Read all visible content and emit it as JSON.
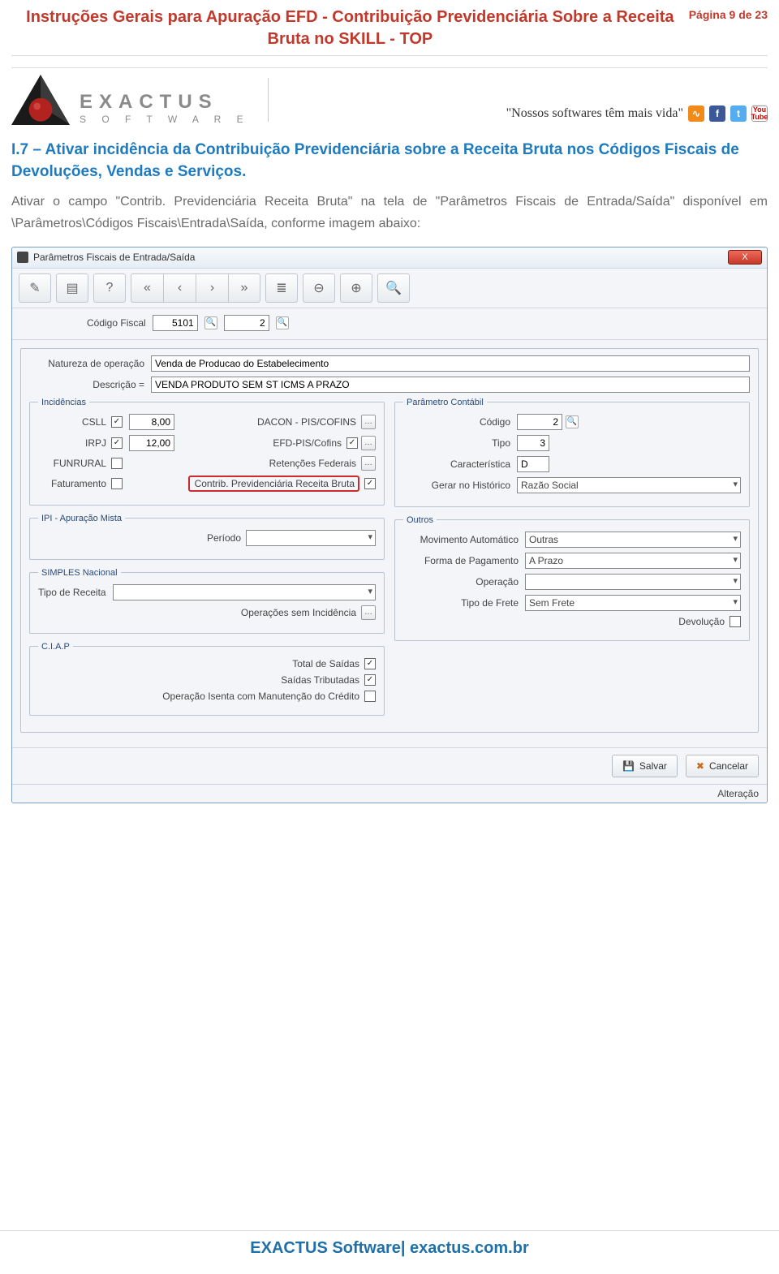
{
  "doc": {
    "title": "Instruções Gerais para Apuração EFD - Contribuição Previdenciária Sobre a Receita Bruta no SKILL - TOP",
    "page_label": "Página 9 de 23",
    "section_heading": "I.7 – Ativar incidência da Contribuição Previdenciária sobre a Receita Bruta nos Códigos Fiscais de Devoluções, Vendas e Serviços.",
    "body": "Ativar o campo \"Contrib. Previdenciária Receita Bruta\" na tela de \"Parâmetros Fiscais de Entrada/Saída\" disponível em \\Parâmetros\\Códigos Fiscais\\Entrada\\Saída, conforme imagem abaixo:"
  },
  "brand": {
    "name_top": "EXACTUS",
    "name_bottom": "S O F T W A R E",
    "tagline": "\"Nossos softwares têm mais vida\"",
    "social_rss": "RSS",
    "social_fb": "f",
    "social_tw": "t",
    "social_yt": "You Tube"
  },
  "app": {
    "title": "Parâmetros Fiscais de Entrada/Saída",
    "close": "X",
    "code_label": "Código Fiscal",
    "code_val1": "5101",
    "code_val2": "2",
    "nat_label": "Natureza de operação",
    "nat_val": "Venda de Producao do Estabelecimento",
    "desc_label": "Descrição =",
    "desc_val": "VENDA PRODUTO SEM ST ICMS A PRAZO",
    "grp_incid": "Incidências",
    "csll_label": "CSLL",
    "csll_val": "8,00",
    "irpj_label": "IRPJ",
    "irpj_val": "12,00",
    "funrural_label": "FUNRURAL",
    "faturamento_label": "Faturamento",
    "dacon_label": "DACON - PIS/COFINS",
    "efd_label": "EFD-PIS/Cofins",
    "retencoes_label": "Retenções Federais",
    "contrib_label": "Contrib. Previdenciária Receita Bruta",
    "grp_ipi": "IPI - Apuração Mista",
    "periodo_label": "Período",
    "grp_simples": "SIMPLES Nacional",
    "tipo_receita_label": "Tipo de Receita",
    "op_sem_inc_label": "Operações sem Incidência",
    "grp_ciap": "C.I.A.P",
    "total_saidas_label": "Total de Saídas",
    "saidas_trib_label": "Saídas Tributadas",
    "op_isenta_label": "Operação Isenta com Manutenção do Crédito",
    "grp_param": "Parâmetro Contábil",
    "p_codigo_label": "Código",
    "p_codigo_val": "2",
    "p_tipo_label": "Tipo",
    "p_tipo_val": "3",
    "p_carac_label": "Característica",
    "p_carac_val": "D",
    "p_gerar_label": "Gerar no Histórico",
    "p_gerar_val": "Razão Social",
    "grp_outros": "Outros",
    "o_mov_label": "Movimento Automático",
    "o_mov_val": "Outras",
    "o_forma_label": "Forma de Pagamento",
    "o_forma_val": "A Prazo",
    "o_op_label": "Operação",
    "o_op_val": "",
    "o_frete_label": "Tipo de Frete",
    "o_frete_val": "Sem Frete",
    "o_dev_label": "Devolução",
    "btn_salvar": "Salvar",
    "btn_cancelar": "Cancelar",
    "status": "Alteração"
  },
  "footer": {
    "text": "EXACTUS Software| exactus.com.br"
  }
}
